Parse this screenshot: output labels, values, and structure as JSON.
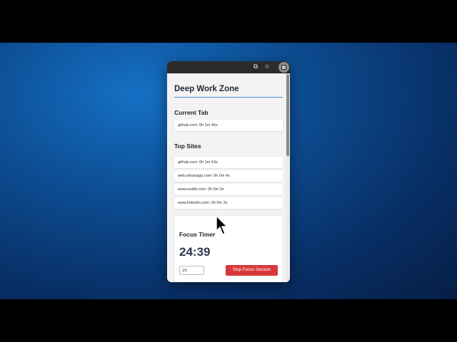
{
  "toolbar": {
    "icons": [
      "cast-icon",
      "star-icon",
      "extension-icon"
    ],
    "cast_glyph": "⧉",
    "star_glyph": "☆"
  },
  "app": {
    "title": "Deep Work Zone"
  },
  "current_tab": {
    "heading": "Current Tab",
    "entry": "github.com: 0h 1m 46s"
  },
  "top_sites": {
    "heading": "Top Sites",
    "items": [
      "github.com: 0h 1m 43s",
      "web.whatsapp.com: 0h 0m 4s",
      "www.reddit.com: 0h 0m 3s",
      "www.linkedin.com: 0h 0m 3s"
    ]
  },
  "focus_timer": {
    "heading": "Focus Timer",
    "time_remaining": "24:39",
    "minutes_value": "25",
    "stop_button_label": "Stop Focus Session"
  },
  "colors": {
    "accent_rule": "#4a8fd6",
    "stop_button": "#d9383a"
  }
}
